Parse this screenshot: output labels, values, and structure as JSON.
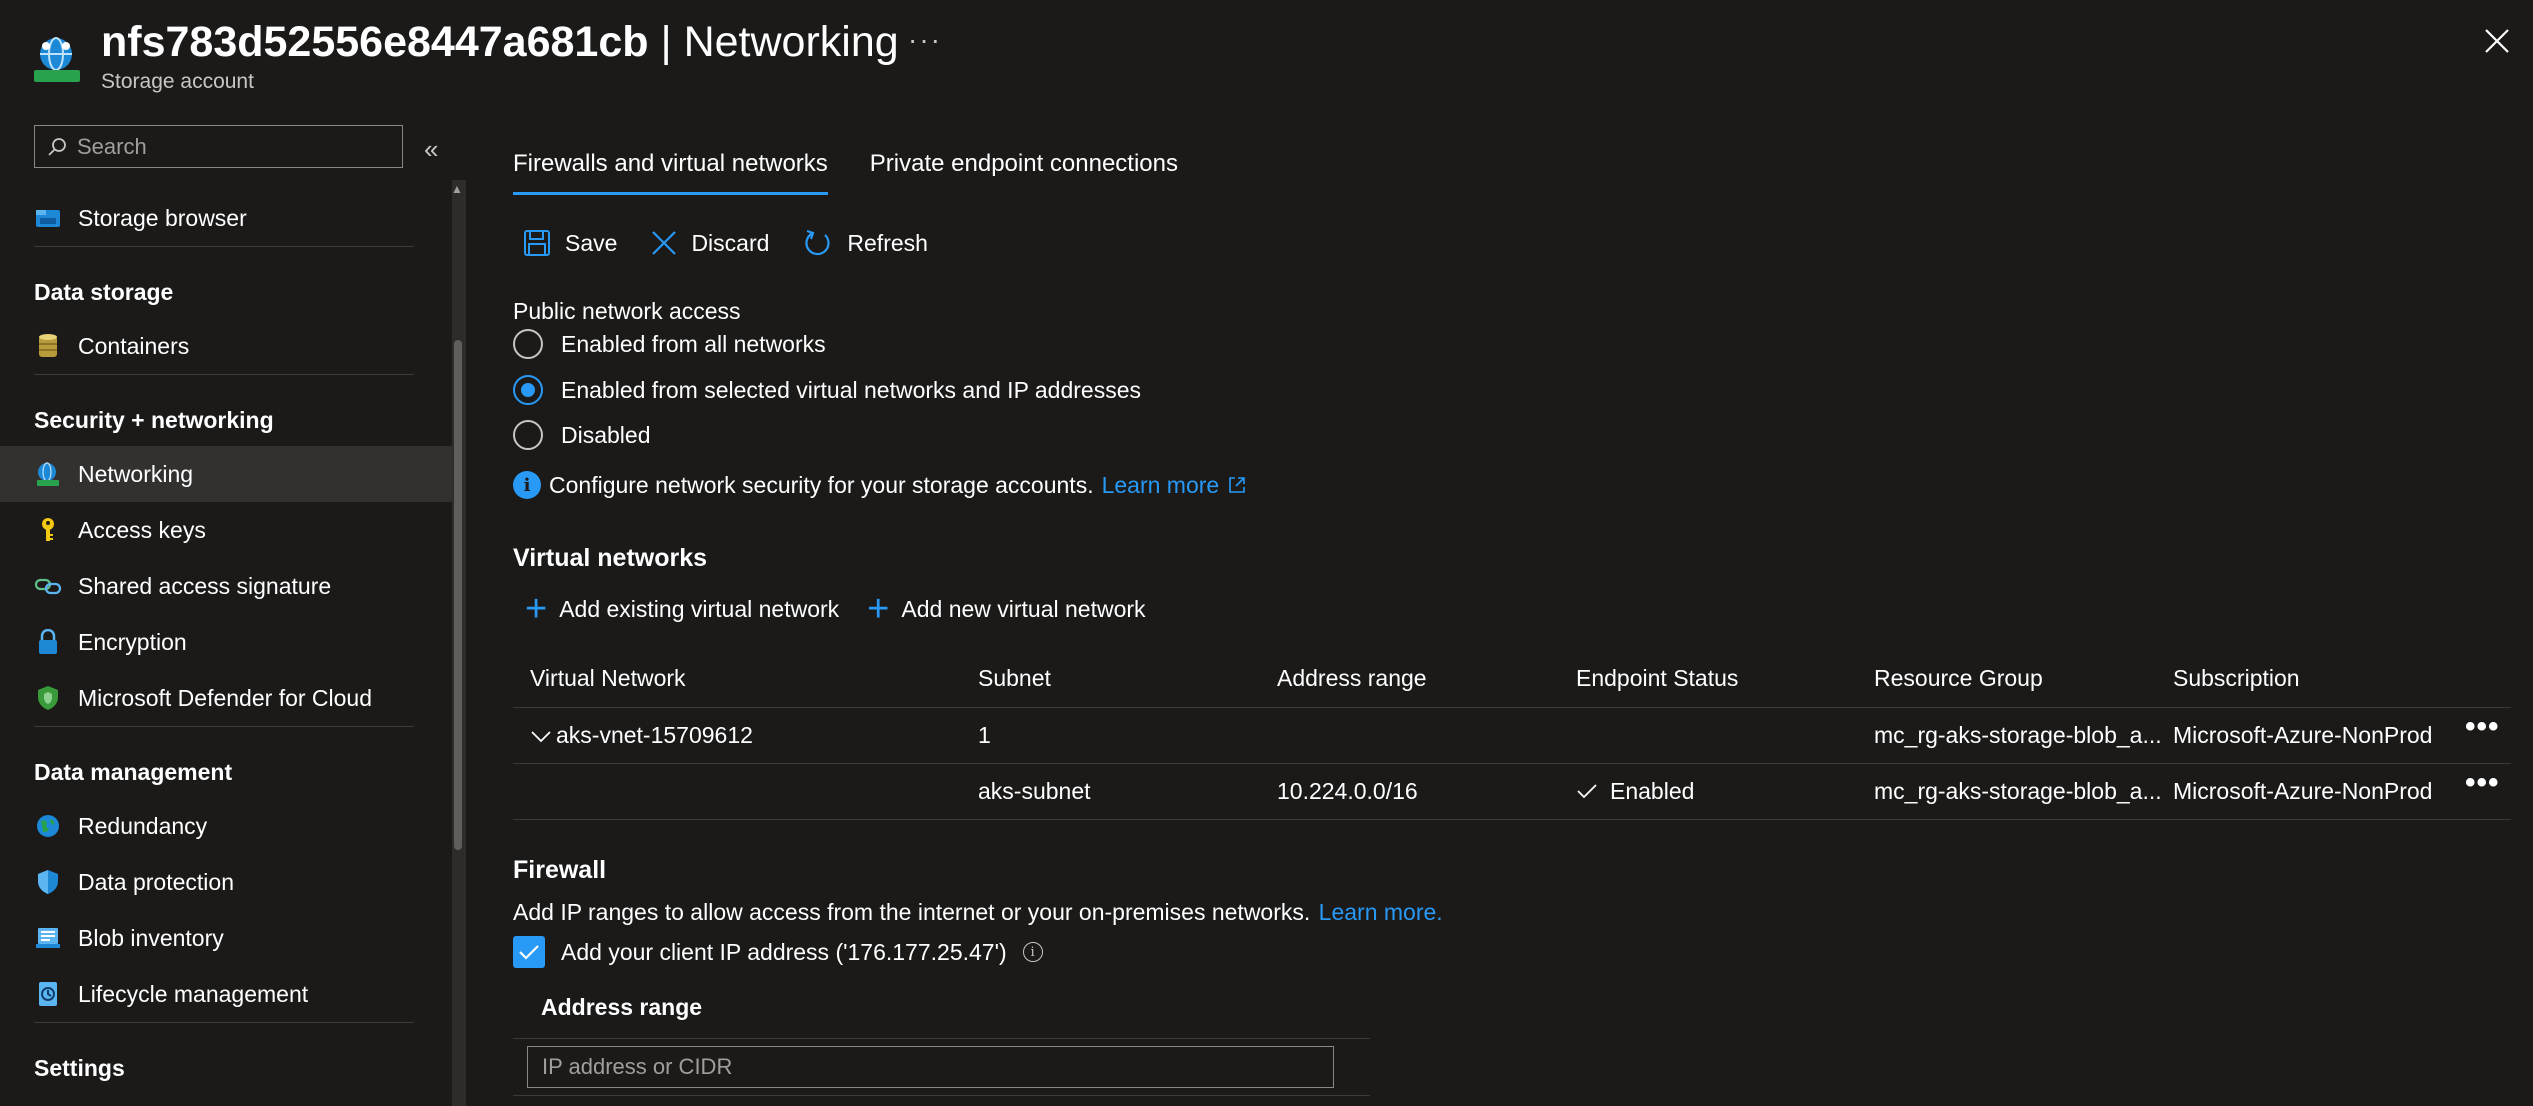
{
  "header": {
    "resource_name": "nfs783d52556e8447a681cb",
    "separator": " | ",
    "page_name": "Networking",
    "subtitle": "Storage account",
    "more": "···"
  },
  "sidebar": {
    "search_placeholder": "Search",
    "collapse": "«",
    "top_item": {
      "label": "Storage browser",
      "icon": "storage-browser-icon"
    },
    "sections": [
      {
        "title": "Data storage",
        "items": [
          {
            "label": "Containers",
            "icon": "containers-icon"
          }
        ]
      },
      {
        "title": "Security + networking",
        "items": [
          {
            "label": "Networking",
            "icon": "networking-icon",
            "active": true
          },
          {
            "label": "Access keys",
            "icon": "key-icon"
          },
          {
            "label": "Shared access signature",
            "icon": "link-icon"
          },
          {
            "label": "Encryption",
            "icon": "lock-icon"
          },
          {
            "label": "Microsoft Defender for Cloud",
            "icon": "shield-icon"
          }
        ]
      },
      {
        "title": "Data management",
        "items": [
          {
            "label": "Redundancy",
            "icon": "globe-icon"
          },
          {
            "label": "Data protection",
            "icon": "protection-shield-icon"
          },
          {
            "label": "Blob inventory",
            "icon": "inventory-icon"
          },
          {
            "label": "Lifecycle management",
            "icon": "lifecycle-icon"
          }
        ]
      },
      {
        "title": "Settings",
        "items": []
      }
    ]
  },
  "main": {
    "tabs": [
      {
        "label": "Firewalls and virtual networks",
        "active": true
      },
      {
        "label": "Private endpoint connections",
        "active": false
      }
    ],
    "toolbar": {
      "save": "Save",
      "discard": "Discard",
      "refresh": "Refresh"
    },
    "public_network_access": {
      "label": "Public network access",
      "options": [
        {
          "label": "Enabled from all networks",
          "selected": false
        },
        {
          "label": "Enabled from selected virtual networks and IP addresses",
          "selected": true
        },
        {
          "label": "Disabled",
          "selected": false
        }
      ]
    },
    "info": {
      "text": "Configure network security for your storage accounts.",
      "link": "Learn more"
    },
    "virtual_networks": {
      "title": "Virtual networks",
      "add_existing": "Add existing virtual network",
      "add_new": "Add new virtual network",
      "columns": [
        "Virtual Network",
        "Subnet",
        "Address range",
        "Endpoint Status",
        "Resource Group",
        "Subscription"
      ],
      "rows": [
        {
          "vnet": "aks-vnet-15709612",
          "subnet": "1",
          "address": "",
          "status": "",
          "rg": "mc_rg-aks-storage-blob_a...",
          "sub": "Microsoft-Azure-NonProd",
          "more": "•••"
        },
        {
          "vnet": "",
          "subnet": "aks-subnet",
          "address": "10.224.0.0/16",
          "status": "Enabled",
          "rg": "mc_rg-aks-storage-blob_a...",
          "sub": "Microsoft-Azure-NonProd",
          "more": "•••"
        }
      ]
    },
    "firewall": {
      "title": "Firewall",
      "desc": "Add IP ranges to allow access from the internet or your on-premises networks.",
      "link": "Learn more.",
      "client_ip_label": "Add your client IP address ('176.177.25.47')",
      "client_ip_checked": true,
      "address_range_header": "Address range",
      "address_placeholder": "IP address or CIDR"
    }
  },
  "colors": {
    "accent": "#2899f5",
    "bg": "#1b1a19",
    "active_nav": "#323130"
  }
}
